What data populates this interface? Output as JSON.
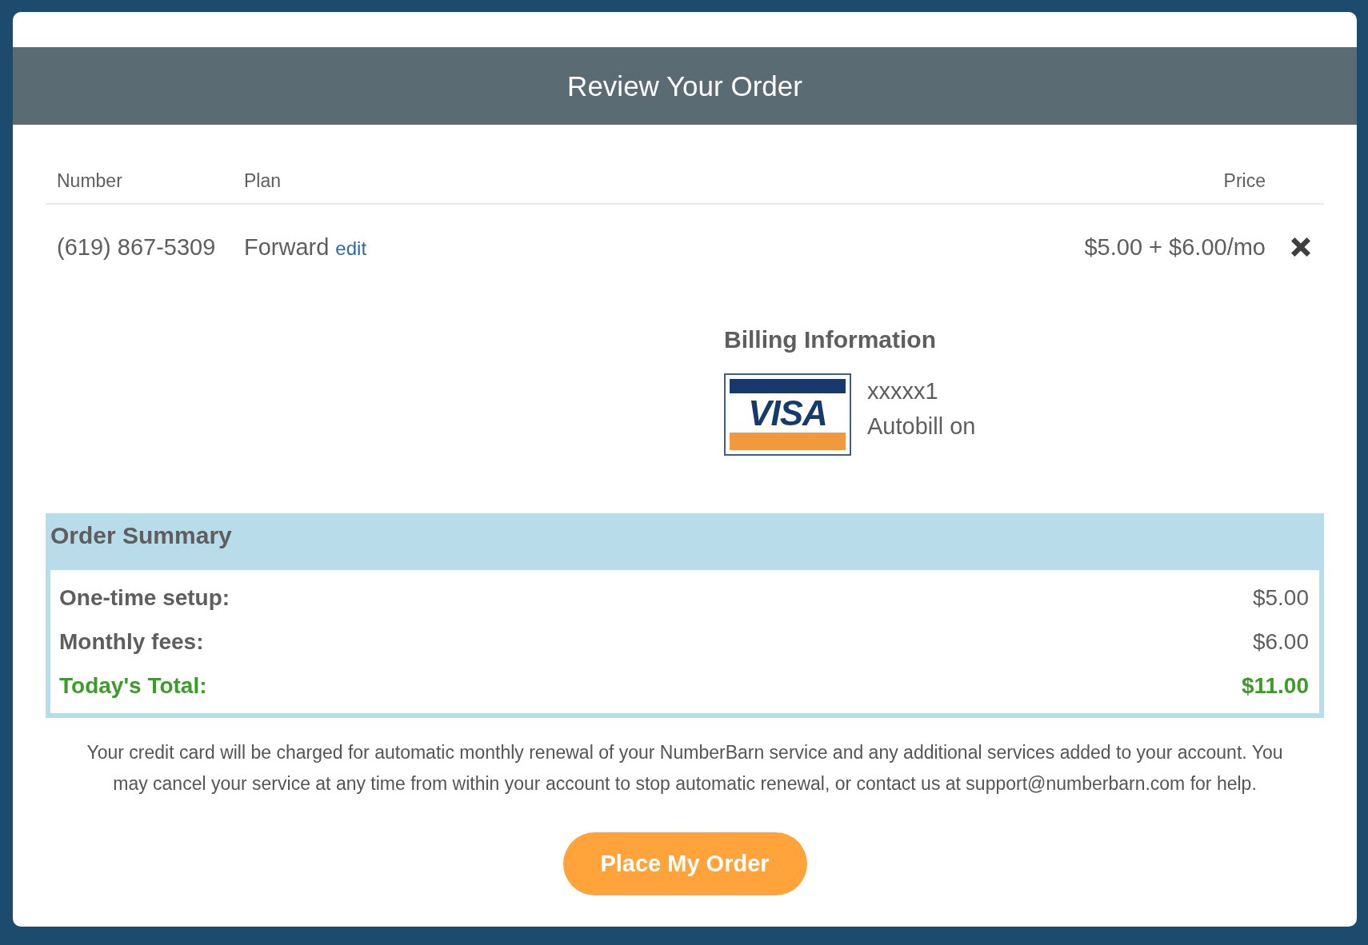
{
  "header": {
    "title": "Review Your Order"
  },
  "table": {
    "columns": [
      "Number",
      "Plan",
      "Price"
    ],
    "rows": [
      {
        "number": "(619) 867-5309",
        "plan": "Forward",
        "edit_link": "edit",
        "price": "$5.00 + $6.00/mo"
      }
    ]
  },
  "billing": {
    "title": "Billing Information",
    "card_brand": "VISA",
    "card_number": "xxxxx1",
    "autobill": "Autobill on"
  },
  "order_summary": {
    "title": "Order Summary",
    "lines": [
      {
        "kind": "line",
        "label": "One-time setup:",
        "value": "$5.00"
      },
      {
        "kind": "line",
        "label": "Monthly fees:",
        "value": "$6.00"
      },
      {
        "kind": "total",
        "label": "Today's Total:",
        "value": "$11.00"
      }
    ]
  },
  "notice": "Your credit card will be charged for automatic monthly renewal of your NumberBarn service and any additional services added to your account. You may cancel your service at any time from within your account to stop automatic renewal, or contact us at support@numberbarn.com for help.",
  "button": {
    "label": "Place My Order"
  }
}
